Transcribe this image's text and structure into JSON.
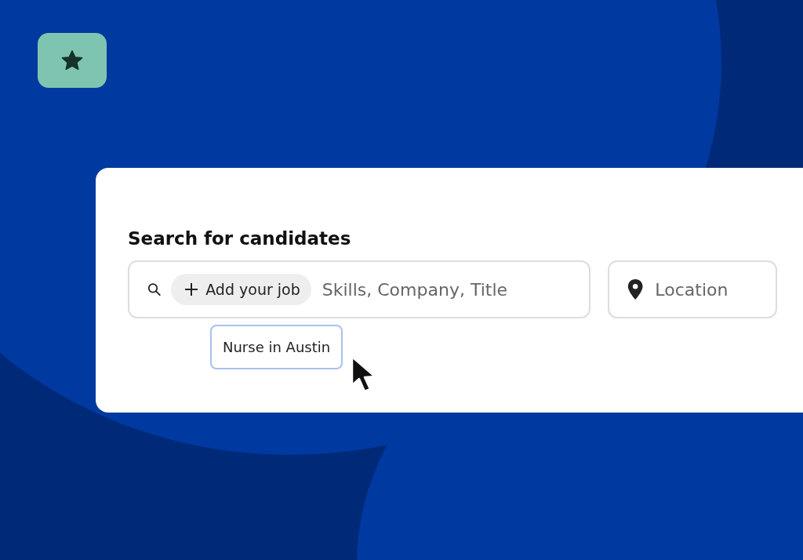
{
  "title": "Search for candidates",
  "search": {
    "chip": "Add your job",
    "placeholder": "Skills, Company, Title"
  },
  "location": {
    "placeholder": "Location"
  },
  "suggestion": "Nurse in Austin"
}
